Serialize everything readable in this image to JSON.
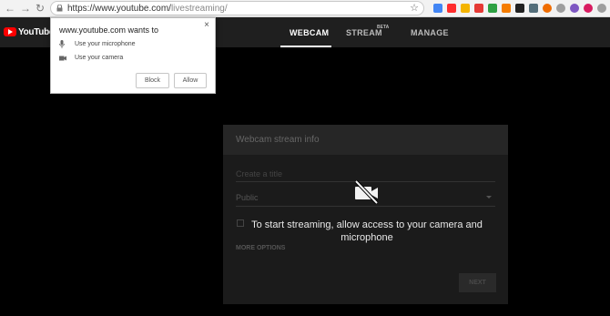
{
  "browser": {
    "back_icon": "back-arrow-icon",
    "forward_icon": "forward-arrow-icon",
    "reload_icon": "reload-icon",
    "url_prefix": "https://www.youtube.com/",
    "url_path": "livestreaming/",
    "extension_colors": [
      "#4285f4",
      "#ff2d2d",
      "#f4b400",
      "#e53935",
      "#2ea043",
      "#f57c00",
      "#212121",
      "#546e7a",
      "#ef6c00",
      "#9e9e9e",
      "#7e57c2",
      "#d81b60",
      "#9e9e9e"
    ]
  },
  "youtube": {
    "logo_text": "YouTube",
    "tabs": [
      {
        "label": "WEBCAM"
      },
      {
        "label": "STREAM"
      },
      {
        "label": "MANAGE"
      }
    ],
    "stream_badge": "BETA"
  },
  "permission_popup": {
    "title": "www.youtube.com wants to",
    "items": [
      {
        "label": "Use your microphone",
        "icon": "microphone-icon"
      },
      {
        "label": "Use your camera",
        "icon": "camera-icon"
      }
    ],
    "block_label": "Block",
    "allow_label": "Allow",
    "close_glyph": "×"
  },
  "webcam_panel": {
    "header": "Webcam stream info",
    "title_placeholder": "Create a title",
    "privacy_value": "Public",
    "more_options": "MORE OPTIONS",
    "next_label": "NEXT"
  },
  "overlay": {
    "message": "To start streaming, allow access to your camera and microphone",
    "icon": "camera-off-icon"
  }
}
